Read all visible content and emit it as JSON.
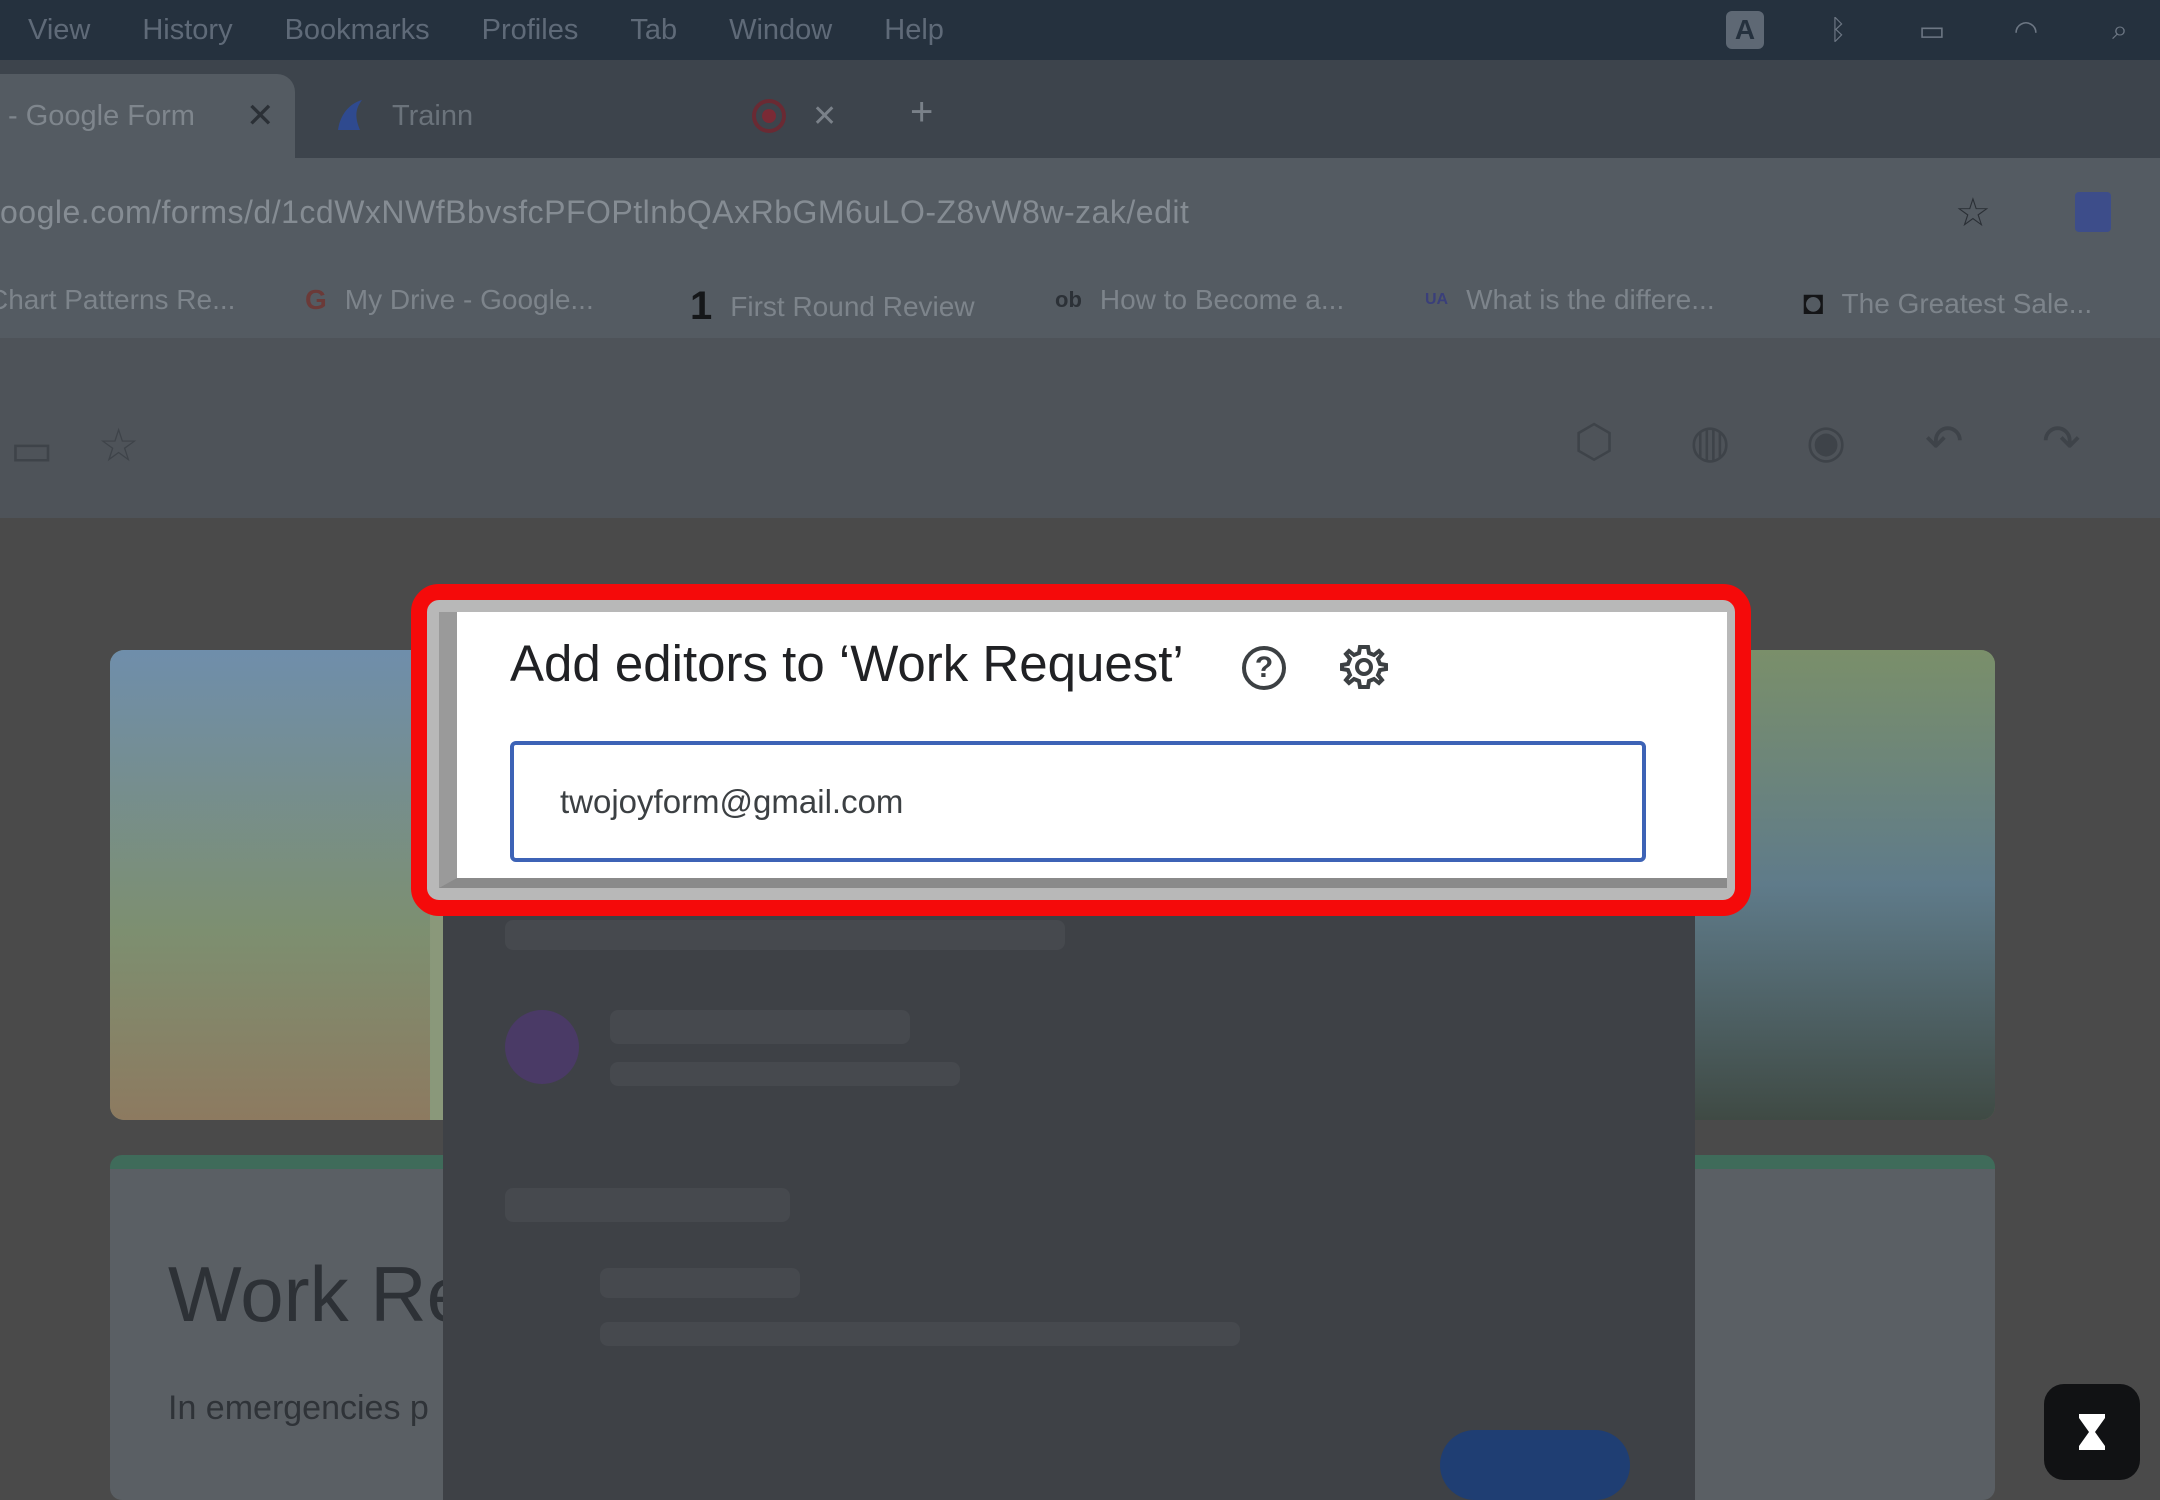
{
  "menubar": {
    "items": [
      "View",
      "History",
      "Bookmarks",
      "Profiles",
      "Tab",
      "Window",
      "Help"
    ],
    "tray_icons": [
      "keyboard-input-icon",
      "bluetooth-icon",
      "battery-icon",
      "wifi-icon",
      "spotlight-search-icon"
    ]
  },
  "tabs": {
    "active_label": "- Google Form",
    "active_close": "✕",
    "second_label": "Trainn",
    "second_close": "✕",
    "new_tab": "+"
  },
  "address_bar": {
    "url": "oogle.com/forms/d/1cdWxNWfBbvsfcPFOPtlnbQAxRbGM6uLO-Z8vW8w-zak/edit",
    "star": "☆"
  },
  "bookmarks": [
    {
      "icon": "chart-icon",
      "glyph": "",
      "label": "Chart Patterns Re..."
    },
    {
      "icon": "google-icon",
      "glyph": "G",
      "label": "My Drive - Google..."
    },
    {
      "icon": "first-round-icon",
      "glyph": "1",
      "label": "First Round Review"
    },
    {
      "icon": "ob-icon",
      "glyph": "ob",
      "label": "How to Become a..."
    },
    {
      "icon": "ua-icon",
      "glyph": "UA",
      "label": "What is the differe..."
    },
    {
      "icon": "greatest-sale-icon",
      "glyph": "◘",
      "label": "The Greatest Sale..."
    }
  ],
  "toolbar_icons": [
    "folder-icon",
    "star-icon",
    "addon-icon",
    "palette-icon",
    "preview-icon",
    "undo-icon",
    "redo-icon"
  ],
  "form": {
    "title": "Work Re",
    "description": "In emergencies p"
  },
  "dialog": {
    "title": "Add editors to ‘Work Request’",
    "input_value": "twojoyform@gmail.com",
    "help_glyph": "?"
  },
  "colors": {
    "highlight": "#f50a0a",
    "input_border": "#3d63b6"
  }
}
